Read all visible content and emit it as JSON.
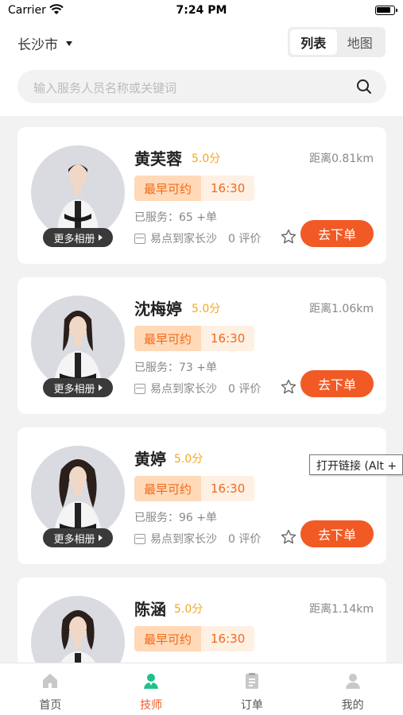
{
  "status_bar": {
    "carrier": "Carrier",
    "time": "7:24 PM"
  },
  "header": {
    "city": "长沙市",
    "view_toggle": {
      "list": "列表",
      "map": "地图",
      "selected": "列表"
    },
    "search": {
      "placeholder": "输入服务人员名称或关键词"
    }
  },
  "technicians": [
    {
      "name": "黄芙蓉",
      "score": "5.0分",
      "distance": "距离0.81km",
      "available_label": "最早可约",
      "available_time": "16:30",
      "served": "已服务：65 +单",
      "shop": "易点到家长沙",
      "reviews": "0 评价",
      "album_label": "更多相册",
      "order_label": "去下单"
    },
    {
      "name": "沈梅婷",
      "score": "5.0分",
      "distance": "距离1.06km",
      "available_label": "最早可约",
      "available_time": "16:30",
      "served": "已服务：73 +单",
      "shop": "易点到家长沙",
      "reviews": "0 评价",
      "album_label": "更多相册",
      "order_label": "去下单"
    },
    {
      "name": "黄婷",
      "score": "5.0分",
      "distance": "",
      "available_label": "最早可约",
      "available_time": "16:30",
      "served": "已服务：96 +单",
      "shop": "易点到家长沙",
      "reviews": "0 评价",
      "album_label": "更多相册",
      "order_label": "去下单"
    },
    {
      "name": "陈涵",
      "score": "5.0分",
      "distance": "距离1.14km",
      "available_label": "最早可约",
      "available_time": "16:30",
      "served": "",
      "shop": "",
      "reviews": "",
      "album_label": "",
      "order_label": ""
    }
  ],
  "tooltip": {
    "text": "打开链接 (Alt +"
  },
  "tab_bar": {
    "items": [
      {
        "label": "首页",
        "icon": "home-icon"
      },
      {
        "label": "技师",
        "icon": "technician-icon"
      },
      {
        "label": "订单",
        "icon": "order-icon"
      },
      {
        "label": "我的",
        "icon": "profile-icon"
      }
    ],
    "active": "技师"
  },
  "colors": {
    "accent": "#f15a24",
    "score": "#f5a623",
    "tab_active": "#f15a24"
  }
}
